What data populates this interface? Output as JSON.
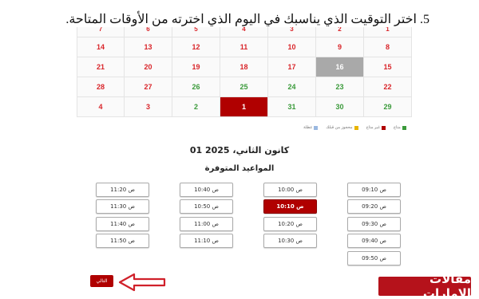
{
  "instruction": "5. اختر التوقيت الذي يناسبك في اليوم الذي اخترته من الأوقات المتاحة.",
  "calendar": {
    "rows": [
      [
        "1",
        "2",
        "3",
        "4",
        "5",
        "6",
        "7"
      ],
      [
        "8",
        "9",
        "10",
        "11",
        "12",
        "13",
        "14"
      ],
      [
        "15",
        "16",
        "17",
        "18",
        "19",
        "20",
        "21"
      ],
      [
        "29",
        "30",
        "31",
        "25",
        "24",
        "26",
        "28"
      ],
      [
        "1",
        "2",
        "3",
        "4",
        "5",
        "6",
        "7"
      ]
    ]
  },
  "legend": {
    "available": "متاح",
    "unavailable": "غير متاح",
    "booked": "محجوز من قبلك",
    "holiday": "عطلة"
  },
  "selected_date": "01 كانون الثاني، 2025",
  "slots_heading": "المواعيد المتوفرة",
  "slots": {
    "col1": [
      "09:10 ص",
      "09:20 ص",
      "09:30 ص",
      "09:40 ص",
      "09:50 ص"
    ],
    "col2": [
      "10:00 ص",
      "10:10 ص",
      "10:20 ص",
      "10:30 ص"
    ],
    "col3": [
      "10:40 ص",
      "10:50 ص",
      "11:00 ص",
      "11:10 ص"
    ],
    "col4": [
      "11:20 ص",
      "11:30 ص",
      "11:40 ص",
      "11:50 ص"
    ]
  },
  "next_button": "التالي",
  "brand": "مقالات الإمارات",
  "colors": {
    "accent": "#b00000",
    "available": "#3a9a3a",
    "unavailable": "#d9252a",
    "disabled": "#a9a9a9"
  }
}
